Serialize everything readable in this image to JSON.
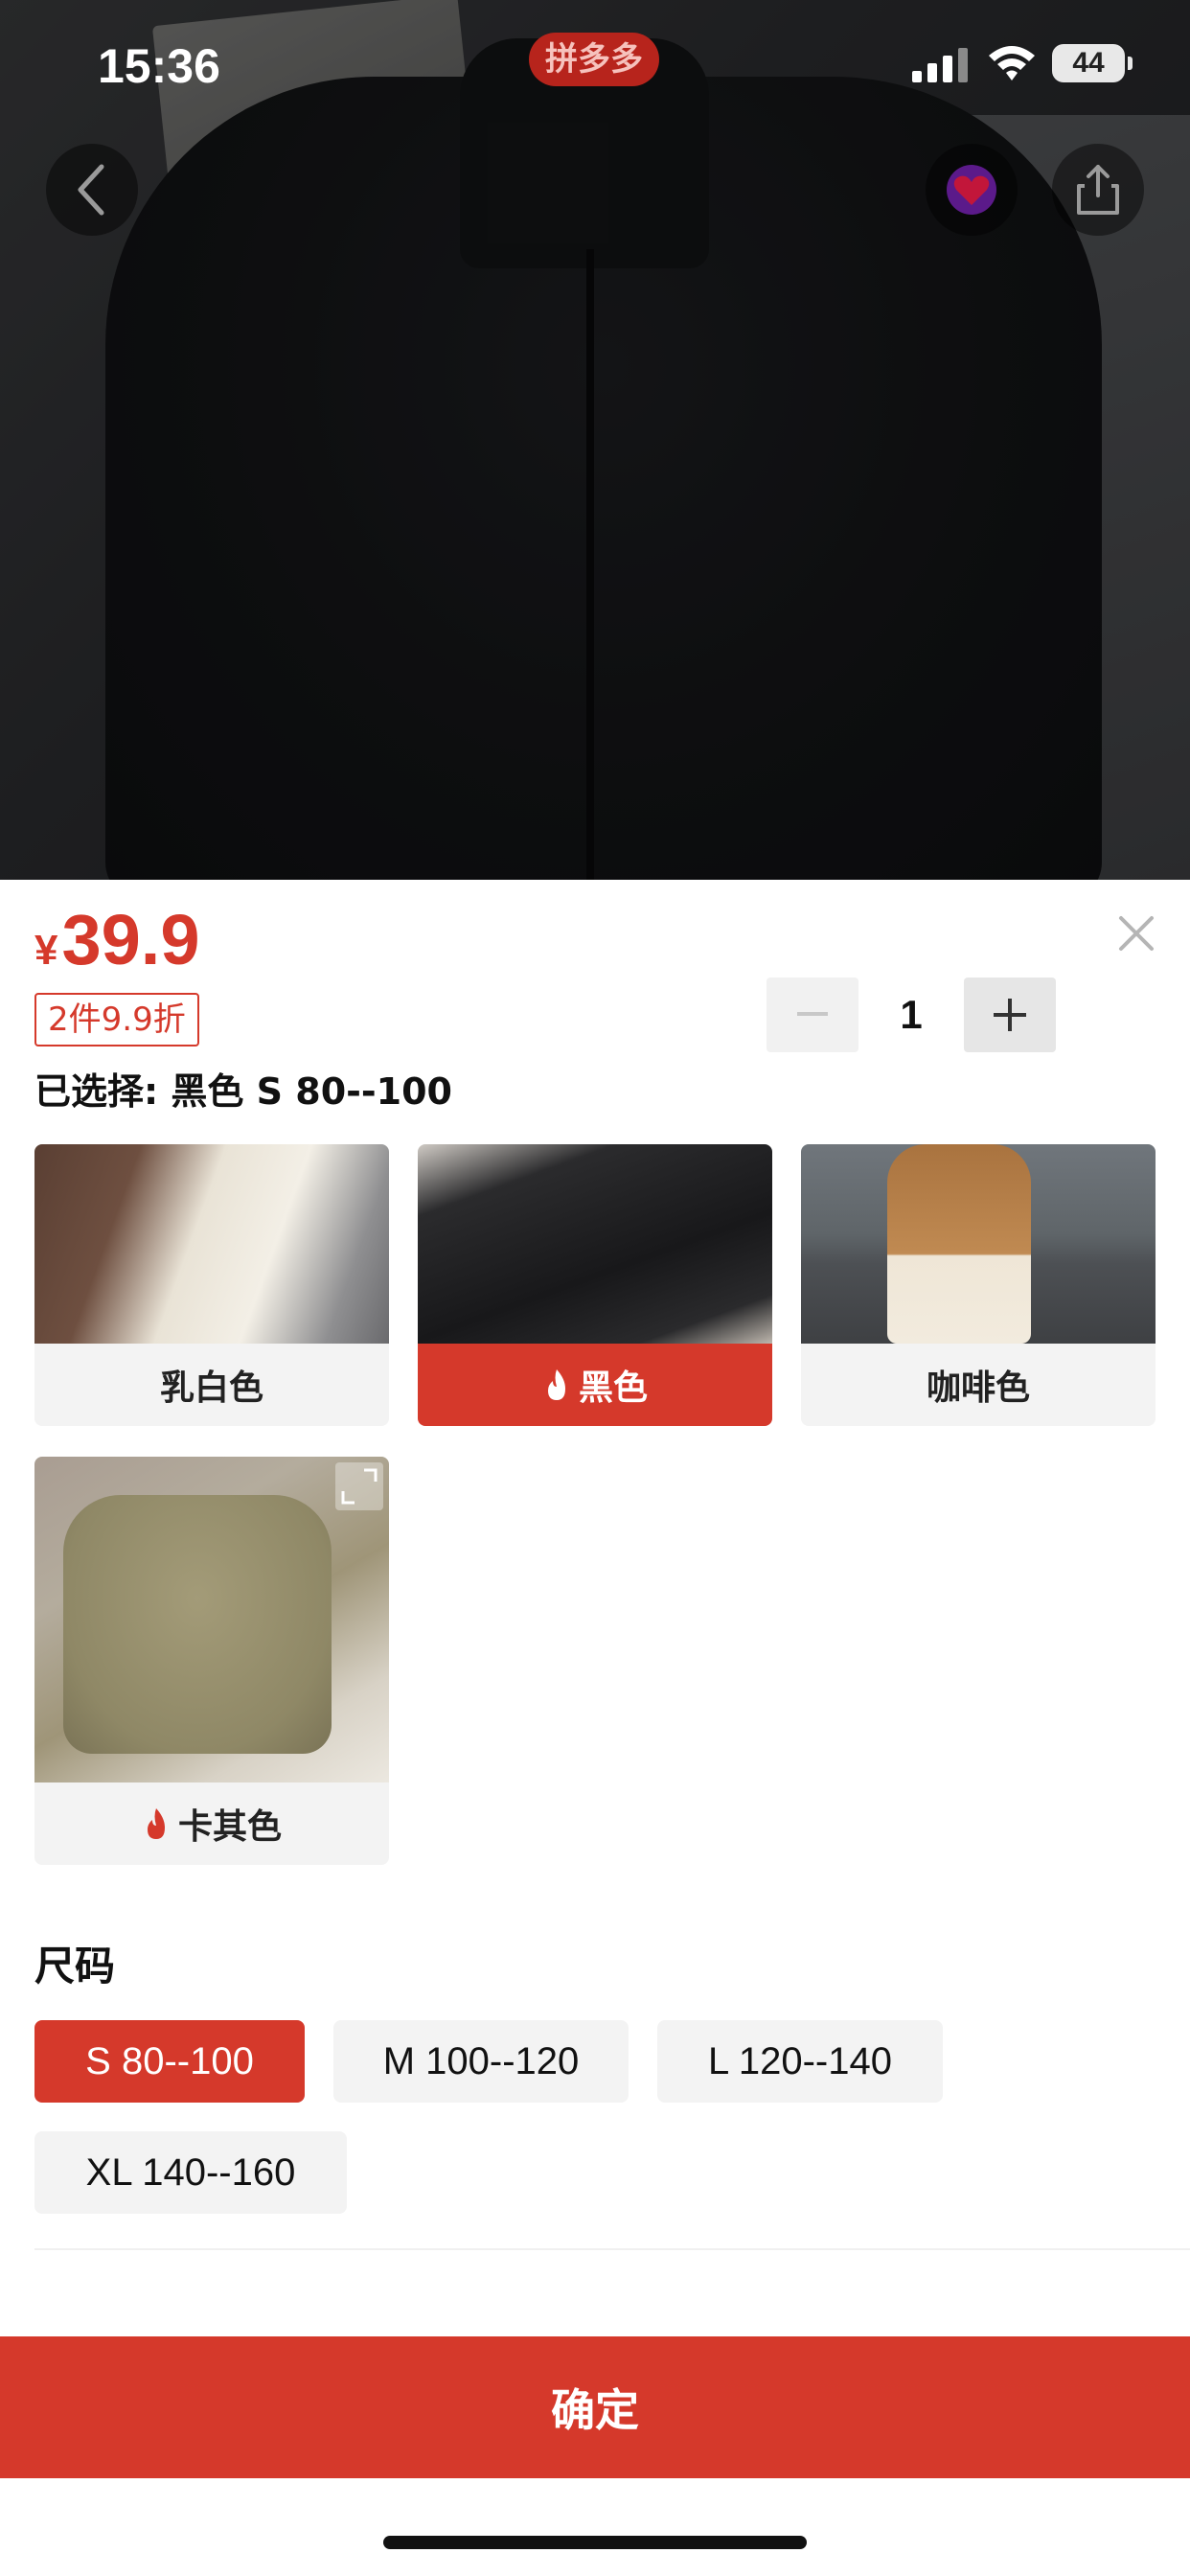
{
  "status_bar": {
    "time": "15:36",
    "app_pill": "拼多多",
    "battery": "44"
  },
  "product": {
    "currency": "¥",
    "price": "39.9",
    "discount_tag": "2件9.9折",
    "quantity": "1",
    "selected_text": "已选择: 黑色 S 80--100"
  },
  "colors": [
    {
      "label": "乳白色",
      "hot": false,
      "active": false
    },
    {
      "label": "黑色",
      "hot": true,
      "active": true
    },
    {
      "label": "咖啡色",
      "hot": false,
      "active": false
    },
    {
      "label": "卡其色",
      "hot": true,
      "active": false
    }
  ],
  "size_section": {
    "title": "尺码",
    "options": [
      "S 80--100",
      "M 100--120",
      "L 120--140",
      "XL 140--160"
    ],
    "selected": "S 80--100"
  },
  "confirm_label": "确定",
  "theme": {
    "accent": "#d5392b"
  }
}
